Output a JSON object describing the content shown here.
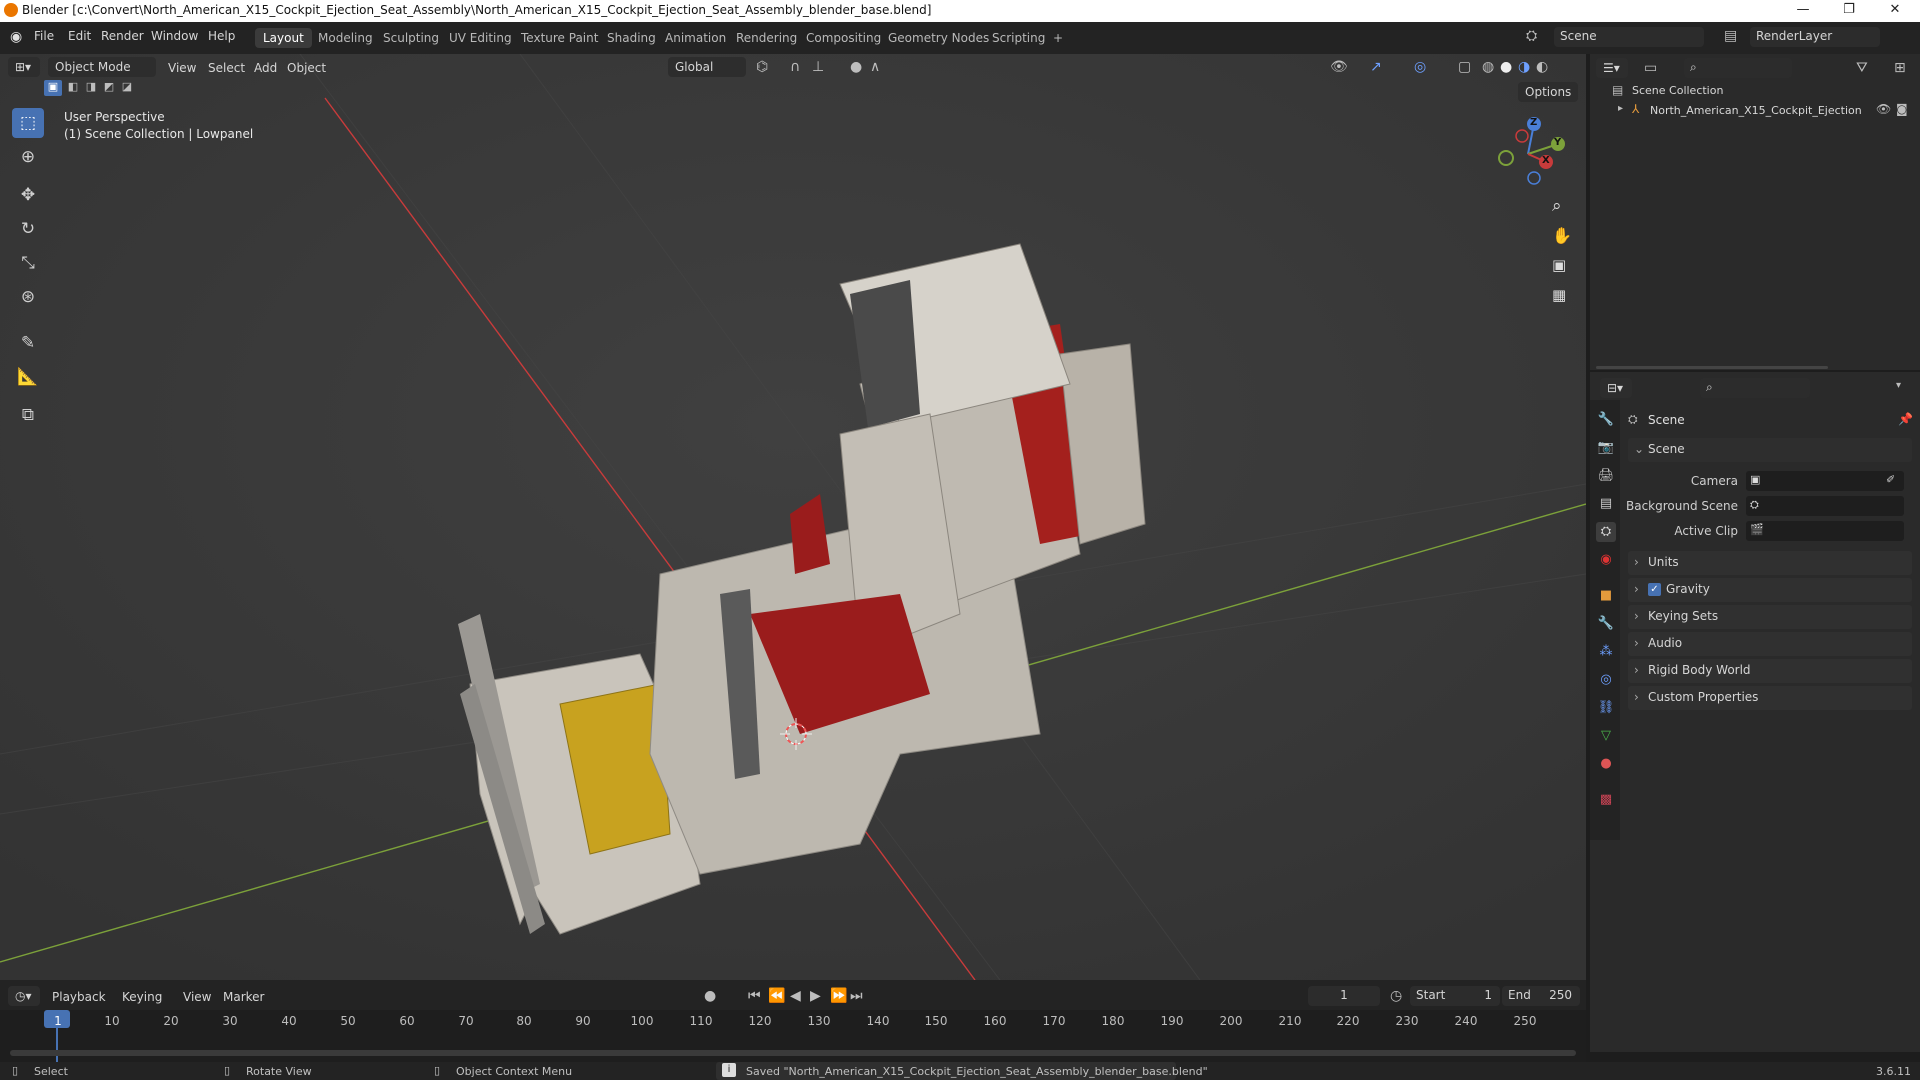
{
  "window": {
    "title": "Blender [c:\\Convert\\North_American_X15_Cockpit_Ejection_Seat_Assembly\\North_American_X15_Cockpit_Ejection_Seat_Assembly_blender_base.blend]",
    "minimize": "—",
    "maximize": "❐",
    "close": "✕"
  },
  "menu": [
    "File",
    "Edit",
    "Render",
    "Window",
    "Help"
  ],
  "workspaces": [
    "Layout",
    "Modeling",
    "Sculpting",
    "UV Editing",
    "Texture Paint",
    "Shading",
    "Animation",
    "Rendering",
    "Compositing",
    "Geometry Nodes",
    "Scripting",
    "+"
  ],
  "scene_selector": {
    "scene": "Scene",
    "view_layer": "RenderLayer"
  },
  "viewport": {
    "mode": "Object Mode",
    "menus": [
      "View",
      "Select",
      "Add",
      "Object"
    ],
    "orientation": "Global",
    "options": "Options",
    "overlay_title": "User Perspective",
    "overlay_subtitle": "(1) Scene Collection | Lowpanel",
    "gizmo": {
      "x": "X",
      "y": "Y",
      "z": "Z"
    }
  },
  "outliner": {
    "root": "Scene Collection",
    "items": [
      {
        "label": "North_American_X15_Cockpit_Ejection"
      }
    ]
  },
  "properties": {
    "header": "Scene",
    "section": "Scene",
    "fields": [
      {
        "label": "Camera",
        "value": ""
      },
      {
        "label": "Background Scene",
        "value": ""
      },
      {
        "label": "Active Clip",
        "value": ""
      }
    ],
    "panels": [
      "Units",
      "Gravity",
      "Keying Sets",
      "Audio",
      "Rigid Body World",
      "Custom Properties"
    ],
    "gravity_checked": true
  },
  "timeline": {
    "menus": [
      "Playback",
      "Keying",
      "View",
      "Marker"
    ],
    "current_frame": "1",
    "start_label": "Start",
    "start": "1",
    "end_label": "End",
    "end": "250",
    "ticks": [
      "1",
      "10",
      "20",
      "30",
      "40",
      "50",
      "60",
      "70",
      "80",
      "90",
      "100",
      "110",
      "120",
      "130",
      "140",
      "150",
      "160",
      "170",
      "180",
      "190",
      "200",
      "210",
      "220",
      "230",
      "240",
      "250"
    ]
  },
  "status": {
    "select": "Select",
    "rotate": "Rotate View",
    "context": "Object Context Menu",
    "message": "Saved \"North_American_X15_Cockpit_Ejection_Seat_Assembly_blender_base.blend\"",
    "version": "3.6.11"
  },
  "colors": {
    "accent": "#4772b3",
    "axis_x": "#c83b3b",
    "axis_y": "#7ca13a",
    "seat_red": "#9a1c1c"
  }
}
